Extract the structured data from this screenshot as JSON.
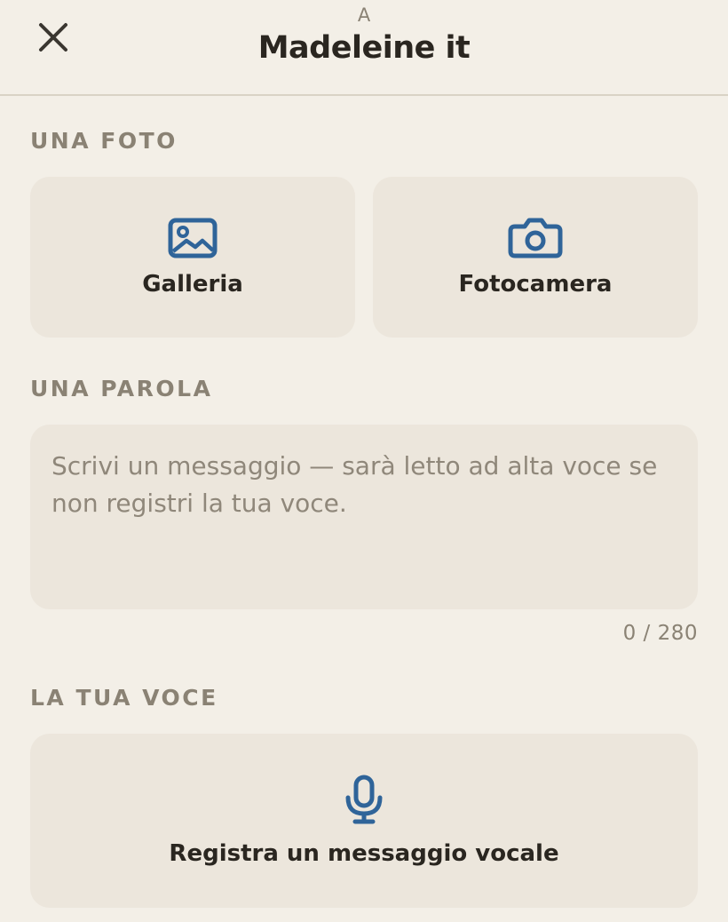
{
  "header": {
    "subtitle": "A",
    "title": "Madeleine it",
    "close_icon": "close-icon"
  },
  "photo_section": {
    "label": "UNA FOTO",
    "gallery": {
      "label": "Galleria",
      "icon": "image-icon"
    },
    "camera": {
      "label": "Fotocamera",
      "icon": "camera-icon"
    }
  },
  "word_section": {
    "label": "UNA PAROLA",
    "message": {
      "value": "",
      "placeholder": "Scrivi un messaggio — sarà letto ad alta voce se non registri la tua voce."
    },
    "counter": "0 / 280"
  },
  "voice_section": {
    "label": "LA TUA VOCE",
    "record": {
      "label": "Registra un messaggio vocale",
      "icon": "microphone-icon"
    }
  },
  "colors": {
    "background": "#f3efe7",
    "tile": "#ece6dc",
    "accent_icon": "#2f6499",
    "label_muted": "#8a8274",
    "text": "#2a2620"
  }
}
